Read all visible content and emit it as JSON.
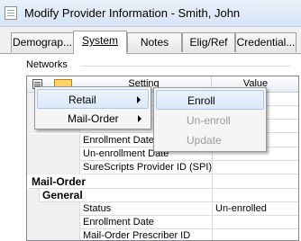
{
  "window": {
    "title": "Modify Provider Information -  Smith, John"
  },
  "tabs": [
    {
      "label": "Demograp..."
    },
    {
      "label": "System"
    },
    {
      "label": "Notes"
    },
    {
      "label": "Elig/Ref"
    },
    {
      "label": "Credential..."
    }
  ],
  "networks": {
    "group_label": "Networks",
    "columns": {
      "setting": "Setting",
      "value": "Value"
    },
    "rows": [
      {
        "setting": "Enrollment Date",
        "value": ""
      },
      {
        "setting": "Un-enrollment Date",
        "value": ""
      },
      {
        "setting": "SureScripts Provider ID (SPI)",
        "value": ""
      },
      {
        "setting": "Mail-Order",
        "value": ""
      },
      {
        "setting": "General",
        "value": ""
      },
      {
        "setting": "Status",
        "value": "Un-enrolled"
      },
      {
        "setting": "Enrollment Date",
        "value": ""
      },
      {
        "setting": "Mail-Order Prescriber ID",
        "value": ""
      }
    ]
  },
  "context_menu": {
    "items": [
      {
        "label": "Retail",
        "highlighted": true
      },
      {
        "label": "Mail-Order"
      }
    ],
    "submenu": [
      {
        "label": "Enroll",
        "highlighted": true
      },
      {
        "label": "Un-enroll",
        "disabled": true
      },
      {
        "label": "Update",
        "disabled": true
      }
    ]
  },
  "icons": {
    "app": "document-icon",
    "list": "list-icon",
    "category": "folder-icon",
    "submenu_arrow": "chevron-right-icon"
  }
}
